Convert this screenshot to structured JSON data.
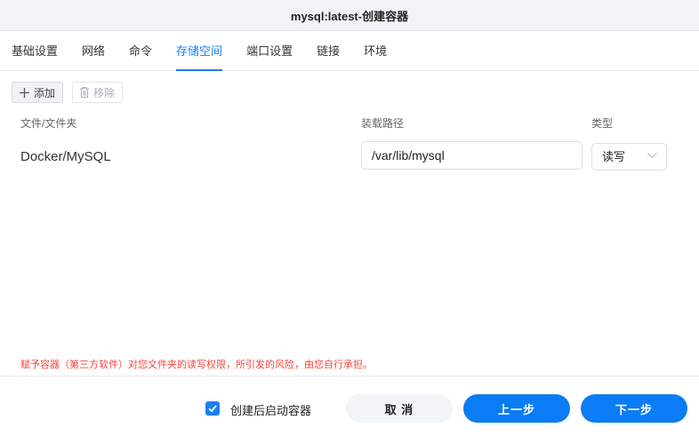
{
  "window": {
    "title": "mysql:latest-创建容器"
  },
  "tabs": [
    {
      "label": "基础设置"
    },
    {
      "label": "网络"
    },
    {
      "label": "命令"
    },
    {
      "label": "存储空间",
      "active": true
    },
    {
      "label": "端口设置"
    },
    {
      "label": "链接"
    },
    {
      "label": "环境"
    }
  ],
  "toolbar": {
    "add_label": "添加",
    "remove_label": "移除"
  },
  "table": {
    "headers": [
      "文件/文件夹",
      "装载路径",
      "类型"
    ],
    "rows": [
      {
        "folder": "Docker/MySQL",
        "mount_path": "/var/lib/mysql",
        "type": "读写"
      }
    ]
  },
  "warning": "赋予容器（第三方软件）对您文件夹的读写权限，所引发的风险，由您自行承担。",
  "footer": {
    "start_after_create_label": "创建后启动容器",
    "start_after_create_checked": true,
    "cancel_label": "取 消",
    "prev_label": "上一步",
    "next_label": "下一步"
  },
  "colors": {
    "accent": "#1a7ff5",
    "warning": "#f0473f"
  }
}
